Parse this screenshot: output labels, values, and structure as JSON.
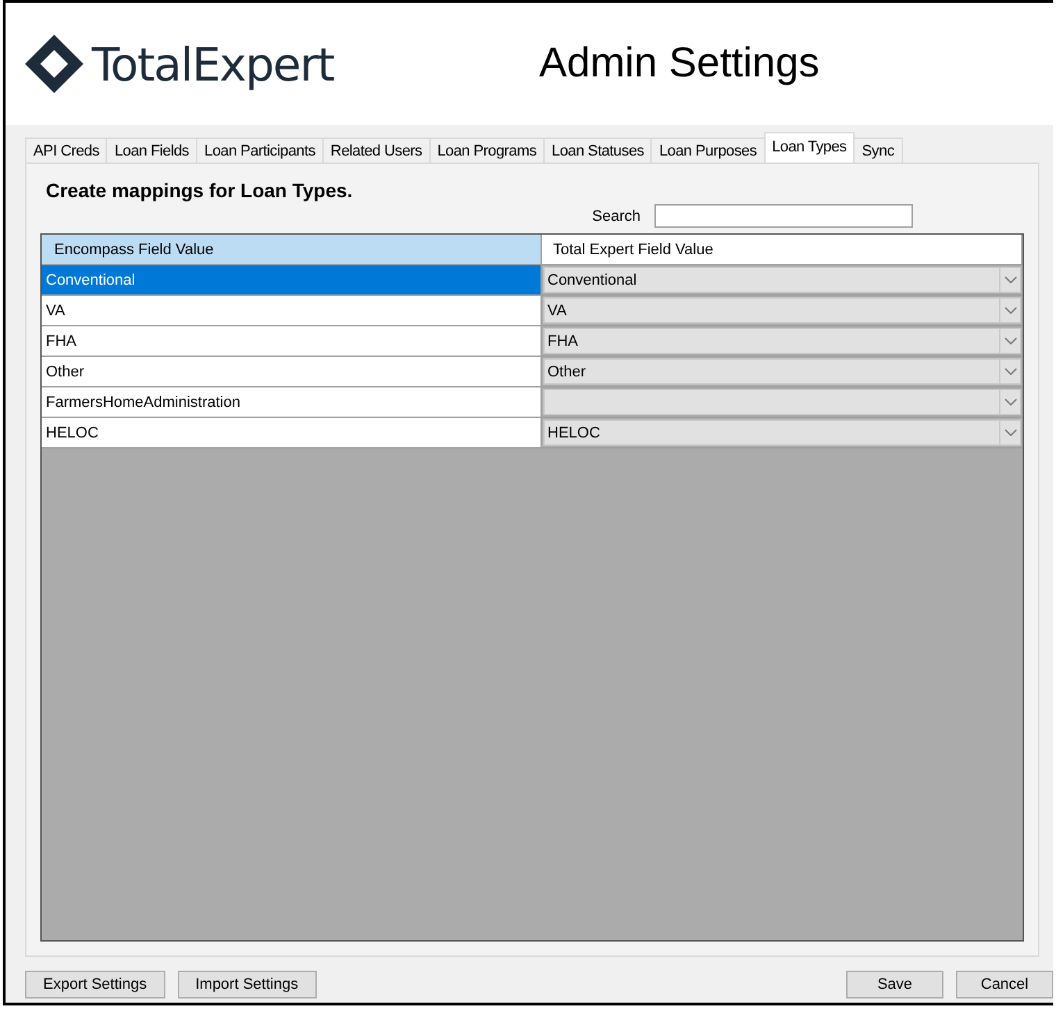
{
  "header": {
    "logo_text": "TotalExpert",
    "title": "Admin Settings"
  },
  "tabs": [
    {
      "label": "API Creds",
      "selected": false
    },
    {
      "label": "Loan Fields",
      "selected": false
    },
    {
      "label": "Loan Participants",
      "selected": false
    },
    {
      "label": "Related Users",
      "selected": false
    },
    {
      "label": "Loan Programs",
      "selected": false
    },
    {
      "label": "Loan Statuses",
      "selected": false
    },
    {
      "label": "Loan Purposes",
      "selected": false
    },
    {
      "label": "Loan Types",
      "selected": true
    },
    {
      "label": "Sync",
      "selected": false
    }
  ],
  "panel": {
    "heading": "Create mappings for Loan Types.",
    "search": {
      "label": "Search"
    }
  },
  "table": {
    "columns": [
      "Encompass Field Value",
      "Total Expert Field Value"
    ],
    "rows": [
      {
        "encompass": "Conventional",
        "total_expert": "Conventional",
        "selected": true
      },
      {
        "encompass": "VA",
        "total_expert": "VA",
        "selected": false
      },
      {
        "encompass": "FHA",
        "total_expert": "FHA",
        "selected": false
      },
      {
        "encompass": "Other",
        "total_expert": "Other",
        "selected": false
      },
      {
        "encompass": "FarmersHomeAdministration",
        "selected": false
      },
      {
        "encompass": "HELOC",
        "total_expert": "HELOC",
        "selected": false
      }
    ]
  },
  "footer": {
    "left_buttons": [
      "Export Settings",
      "Import Settings"
    ],
    "right_buttons": [
      "Save",
      "Cancel"
    ]
  }
}
